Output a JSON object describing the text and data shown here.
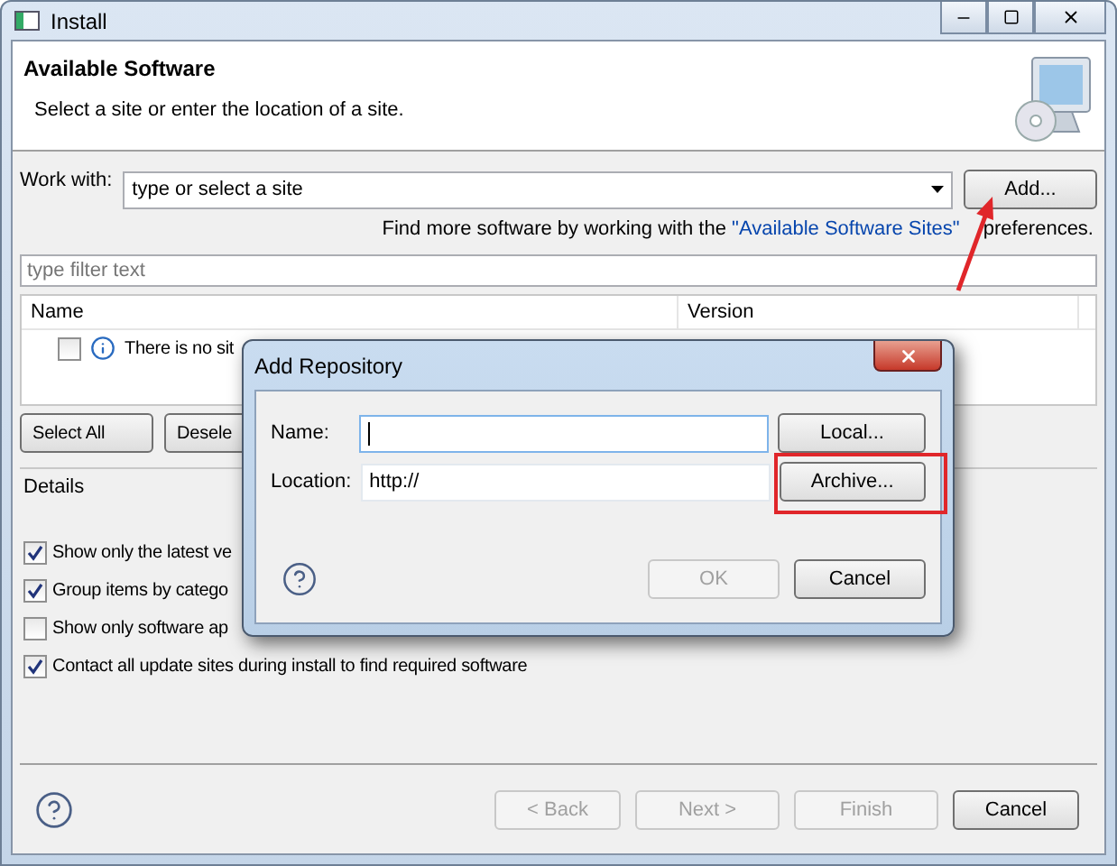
{
  "window": {
    "title": "Install"
  },
  "header": {
    "title": "Available Software",
    "description": "Select a site or enter the location of a site."
  },
  "work_with": {
    "label": "Work with:",
    "value": "type or select a site",
    "button": "Add..."
  },
  "hint": {
    "before": "Find more software by working with the",
    "link": "\"Available Software Sites\"",
    "after": "preferences."
  },
  "filter": {
    "placeholder": "type filter text"
  },
  "table": {
    "columns": [
      "Name",
      "Version"
    ],
    "rows": [
      {
        "checked": false,
        "text": "There is no sit"
      }
    ]
  },
  "selection_buttons": [
    "Select All",
    "Desele"
  ],
  "details": {
    "label": "Details"
  },
  "options": [
    {
      "label": "Show only the latest ve",
      "checked": true
    },
    {
      "label": "Group items by catego",
      "checked": true
    },
    {
      "label": "Show only software ap",
      "checked": false
    },
    {
      "label": "Contact all update sites during install to find required software",
      "checked": true
    }
  ],
  "footer_buttons": [
    {
      "label": "< Back",
      "disabled": true
    },
    {
      "label": "Next >",
      "disabled": true
    },
    {
      "label": "Finish",
      "disabled": true
    },
    {
      "label": "Cancel",
      "disabled": false
    }
  ],
  "dialog": {
    "title": "Add Repository",
    "fields": [
      {
        "label": "Name:",
        "button": "Local...",
        "focused": true
      },
      {
        "label": "Location:",
        "value": "http://",
        "button": "Archive...",
        "focused": false
      }
    ],
    "buttons": [
      {
        "label": "OK",
        "disabled": true
      },
      {
        "label": "Cancel",
        "disabled": false
      }
    ]
  }
}
